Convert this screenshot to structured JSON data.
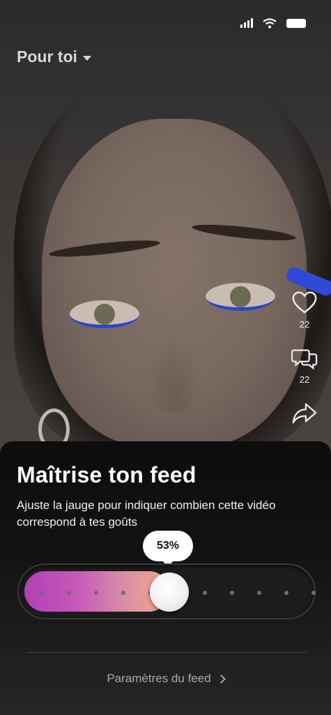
{
  "header": {
    "feed_label": "Pour toi"
  },
  "actions": {
    "likes_count": "22",
    "comments_count": "22"
  },
  "sheet": {
    "title": "Maîtrise ton feed",
    "description": "Ajuste la jauge pour indiquer combien cette vidéo correspond à tes goûts",
    "slider": {
      "value_percent": 53,
      "value_label": "53%",
      "fill_gradient": [
        "#b140b6",
        "#d98fa7",
        "#f7c4b2"
      ]
    },
    "settings_link": "Paramètres du feed"
  },
  "icons": {
    "status": [
      "signal-icon",
      "wifi-icon",
      "battery-icon"
    ],
    "rail": [
      "heart-icon",
      "comment-icon",
      "share-icon"
    ],
    "link": "chevron-right-icon",
    "tab": "chevron-down-icon"
  }
}
